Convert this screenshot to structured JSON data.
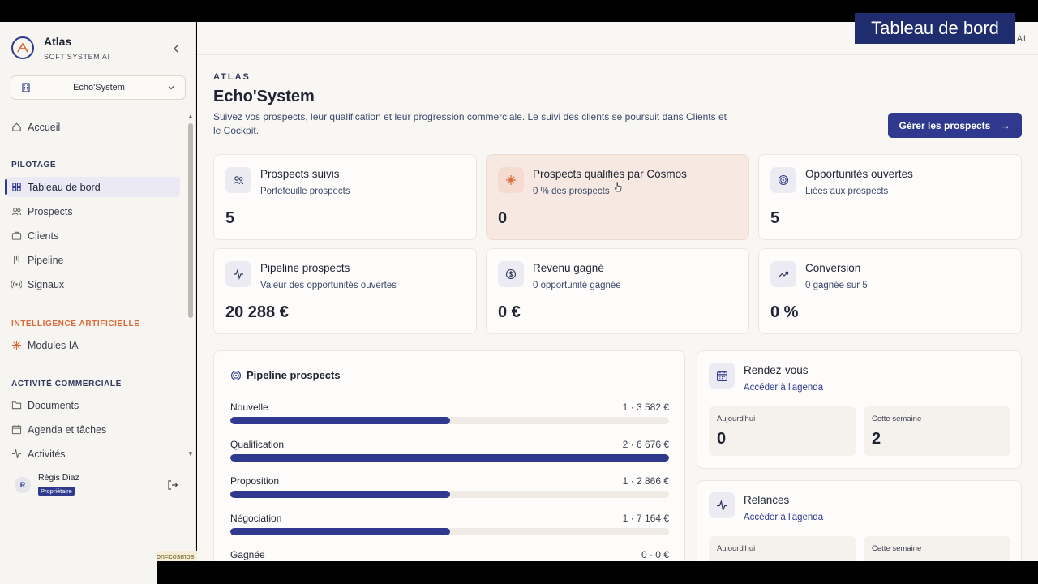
{
  "overlay_title": "Tableau de bord",
  "brand": {
    "name": "Atlas",
    "subtitle": "SOFT'SYSTEM AI"
  },
  "org_select": {
    "value": "Echo'System"
  },
  "nav": {
    "home": "Accueil",
    "section_pilotage": "PILOTAGE",
    "pilotage_items": [
      "Tableau de bord",
      "Prospects",
      "Clients",
      "Pipeline",
      "Signaux"
    ],
    "section_ai": "INTELLIGENCE ARTIFICIELLE",
    "ai_items": [
      "Modules IA"
    ],
    "section_activity": "ACTIVITÉ COMMERCIALE",
    "activity_items": [
      "Documents",
      "Agenda et tâches",
      "Activités"
    ]
  },
  "user": {
    "initial": "R",
    "name": "Régis Diaz",
    "role": "Propriétaire"
  },
  "tooltip_fragment": "on=cosmos",
  "header": {
    "right_label": "AI"
  },
  "page": {
    "eyebrow": "ATLAS",
    "title": "Echo'System",
    "description": "Suivez vos prospects, leur qualification et leur progression commerciale. Le suivi des clients se poursuit dans Clients et le Cockpit.",
    "primary_button": "Gérer les prospects",
    "primary_button_arrow": "→"
  },
  "kpis": [
    {
      "title": "Prospects suivis",
      "subtitle": "Portefeuille prospects",
      "value": "5",
      "icon": "users-icon"
    },
    {
      "title": "Prospects qualifiés par Cosmos",
      "subtitle": "0 % des prospects",
      "value": "0",
      "icon": "sparkle-icon"
    },
    {
      "title": "Opportunités ouvertes",
      "subtitle": "Liées aux prospects",
      "value": "5",
      "icon": "target-icon"
    },
    {
      "title": "Pipeline prospects",
      "subtitle": "Valeur des opportunités ouvertes",
      "value": "20 288 €",
      "icon": "activity-icon"
    },
    {
      "title": "Revenu gagné",
      "subtitle": "0 opportunité gagnée",
      "value": "0 €",
      "icon": "dollar-icon"
    },
    {
      "title": "Conversion",
      "subtitle": "0 gagnée sur 5",
      "value": "0 %",
      "icon": "trend-up-icon"
    }
  ],
  "pipeline": {
    "title": "Pipeline prospects",
    "stages": [
      {
        "label": "Nouvelle",
        "value": "1 · 3 582 €",
        "fill": 0.5
      },
      {
        "label": "Qualification",
        "value": "2 · 6 676 €",
        "fill": 1.0
      },
      {
        "label": "Proposition",
        "value": "1 · 2 866 €",
        "fill": 0.5
      },
      {
        "label": "Négociation",
        "value": "1 · 7 164 €",
        "fill": 0.5
      },
      {
        "label": "Gagnée",
        "value": "0 · 0 €",
        "fill": 0.0
      }
    ]
  },
  "rendezvous": {
    "title": "Rendez-vous",
    "link": "Accéder à l'agenda",
    "today_label": "Aujourd'hui",
    "today_value": "0",
    "week_label": "Cette semaine",
    "week_value": "2"
  },
  "relances": {
    "title": "Relances",
    "link": "Accéder à l'agenda",
    "today_label": "Aujourd'hui",
    "week_label": "Cette semaine"
  },
  "colors": {
    "accent": "#2f3a8f",
    "ai_section": "#d86a3a",
    "highlight_card": "#f7e9e2"
  }
}
